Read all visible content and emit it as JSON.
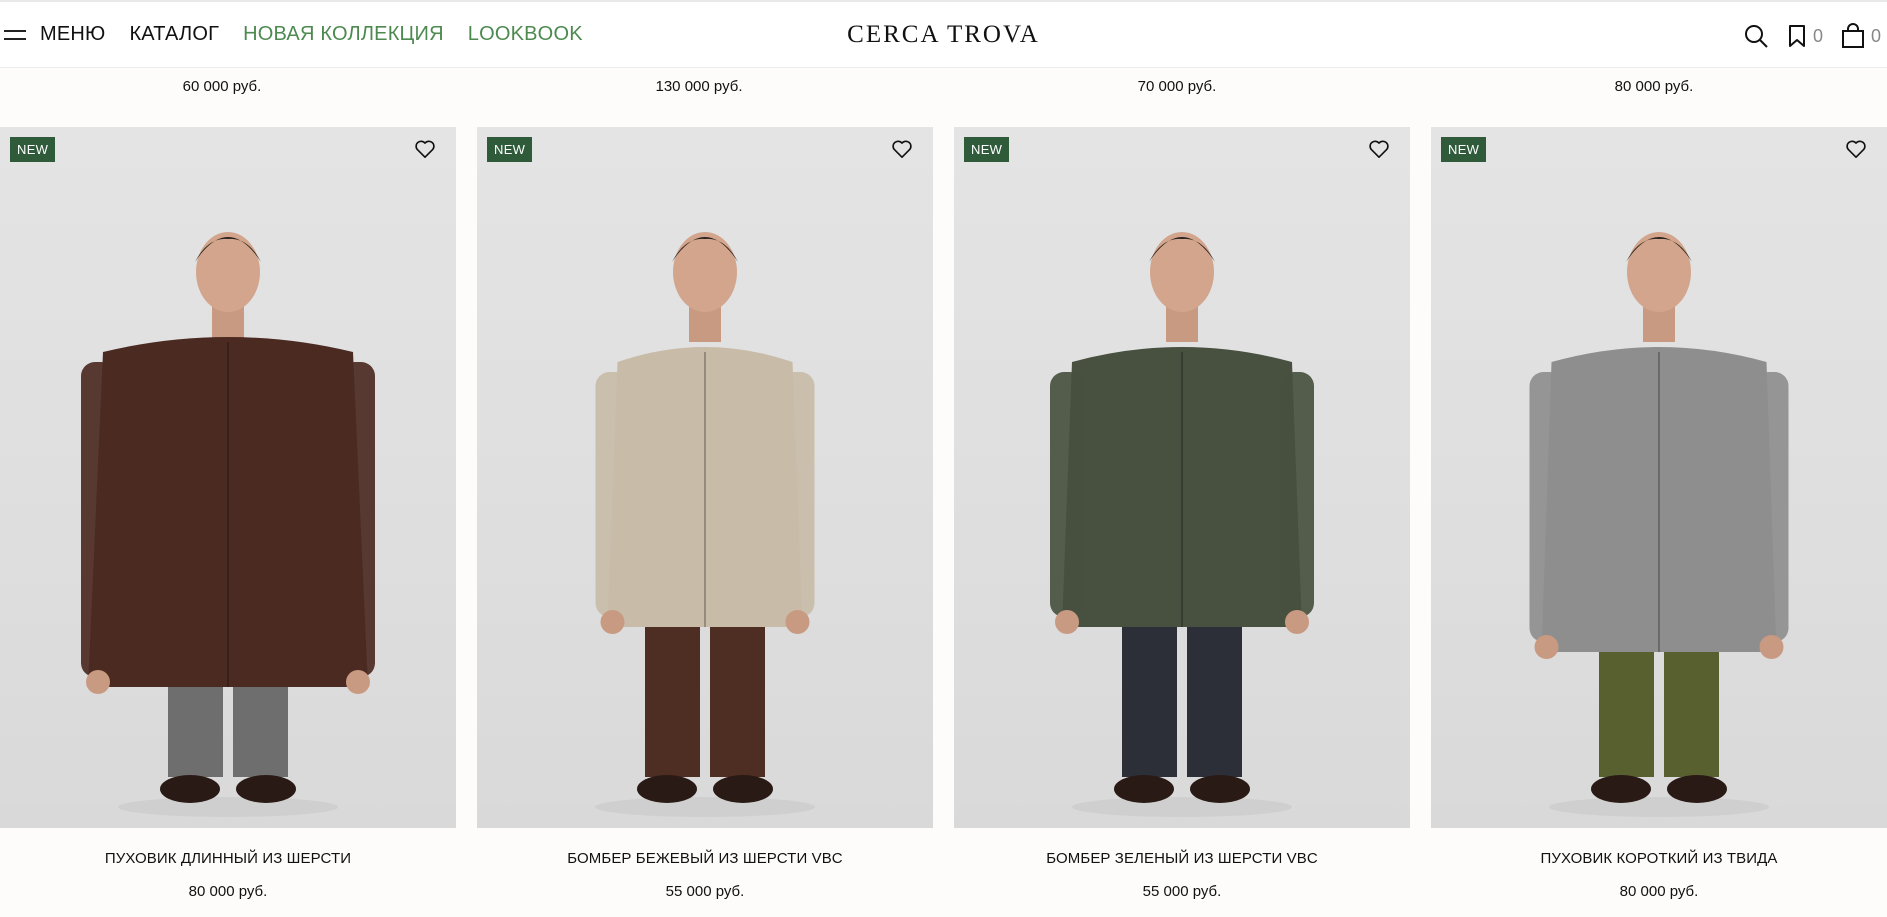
{
  "header": {
    "menu_label": "МЕНЮ",
    "catalog_label": "КАТАЛОГ",
    "new_collection_label": "НОВАЯ КОЛЛЕКЦИЯ",
    "lookbook_label": "LOOKBOOK",
    "logo": "CERCA TROVA",
    "wishlist_count": "0",
    "cart_count": "0",
    "accent_color": "#4d8a4f"
  },
  "previous_row": {
    "prices": [
      "60 000 руб.",
      "130 000 руб.",
      "70 000 руб.",
      "80 000 руб."
    ]
  },
  "products": [
    {
      "badge": "NEW",
      "title": "ПУХОВИК ДЛИННЫЙ ИЗ ШЕРСТИ",
      "price": "80 000 руб.",
      "top_color": "#4b2a22",
      "bottom_color": "#6e6e6e",
      "shoe_color": "#2a1a16",
      "badge_color": "#2f5b3a"
    },
    {
      "badge": "NEW",
      "title": "БОМБЕР БЕЖЕВЫЙ ИЗ ШЕРСТИ VBC",
      "price": "55 000 руб.",
      "top_color": "#c8bba8",
      "bottom_color": "#4e2e22",
      "shoe_color": "#2a1a16",
      "badge_color": "#2f5b3a"
    },
    {
      "badge": "NEW",
      "title": "БОМБЕР ЗЕЛЕНЫЙ ИЗ ШЕРСТИ VBC",
      "price": "55 000 руб.",
      "top_color": "#48503f",
      "bottom_color": "#2c2f38",
      "shoe_color": "#2a1a16",
      "badge_color": "#2f5b3a"
    },
    {
      "badge": "NEW",
      "title": "ПУХОВИК КОРОТКИЙ ИЗ ТВИДА",
      "price": "80 000 руб.",
      "top_color": "#8e8e8e",
      "bottom_color": "#59602f",
      "shoe_color": "#2a1a16",
      "badge_color": "#2f5b3a"
    }
  ]
}
